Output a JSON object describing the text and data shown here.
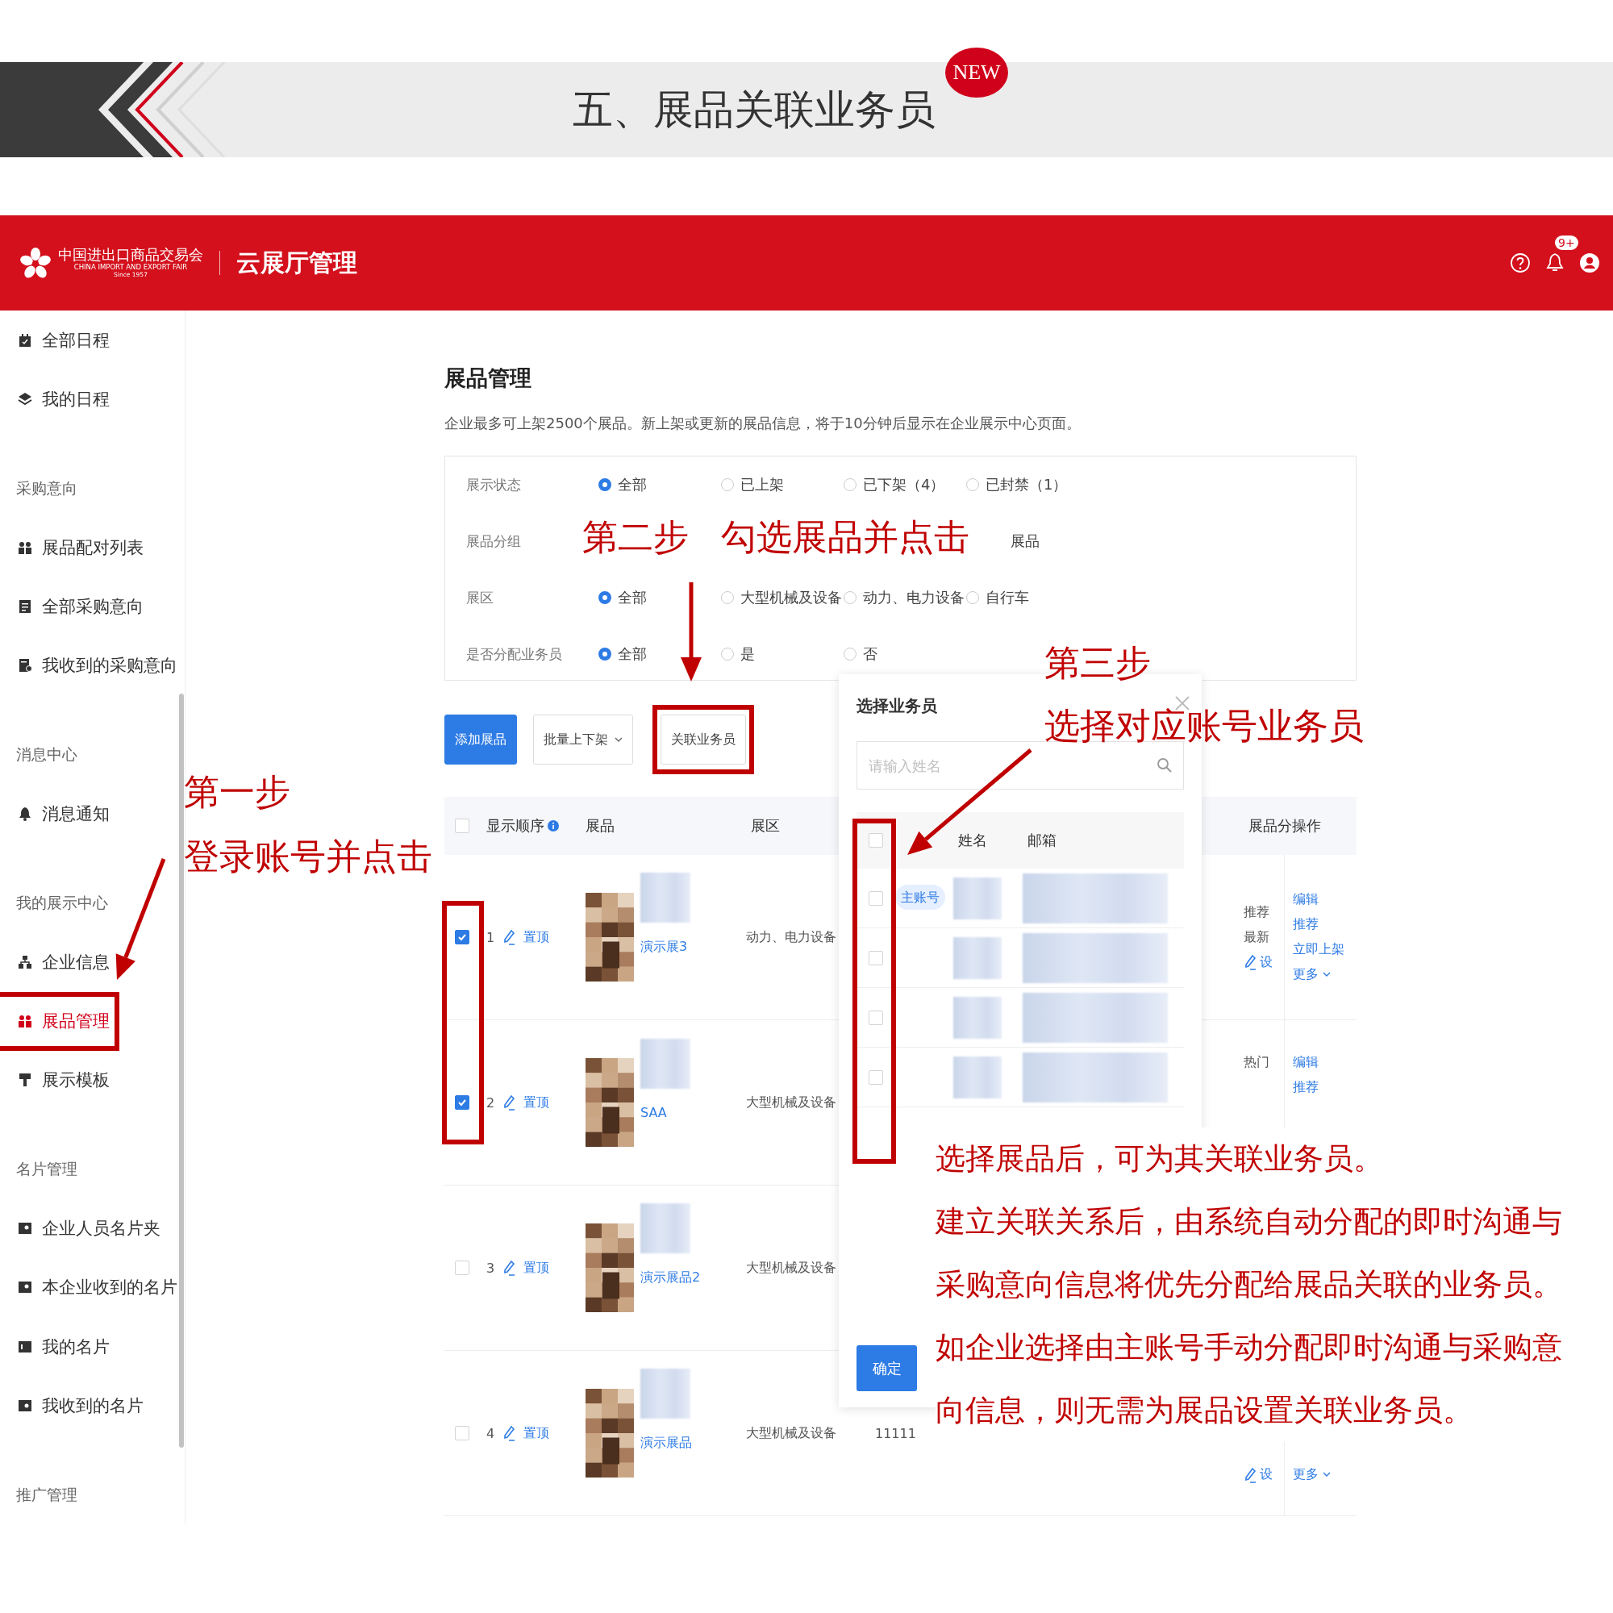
{
  "slide_title": {
    "text": "五、展品关联业务员",
    "badge": "NEW"
  },
  "header": {
    "logo_cn": "中国进出口商品交易会",
    "logo_en": "CHINA IMPORT AND EXPORT FAIR",
    "logo_since": "Since 1957",
    "app_name": "云展厅管理",
    "notification_badge": "9+"
  },
  "sidebar": {
    "items": [
      {
        "kind": "item",
        "label": "全部日程",
        "selected": false
      },
      {
        "kind": "item",
        "label": "我的日程",
        "selected": false
      },
      {
        "kind": "section",
        "label": "采购意向"
      },
      {
        "kind": "item",
        "label": "展品配对列表",
        "selected": false
      },
      {
        "kind": "item",
        "label": "全部采购意向",
        "selected": false
      },
      {
        "kind": "item",
        "label": "我收到的采购意向",
        "selected": false
      },
      {
        "kind": "section",
        "label": "消息中心"
      },
      {
        "kind": "item",
        "label": "消息通知",
        "selected": false
      },
      {
        "kind": "section",
        "label": "我的展示中心"
      },
      {
        "kind": "item",
        "label": "企业信息",
        "selected": false
      },
      {
        "kind": "item",
        "label": "展品管理",
        "selected": true
      },
      {
        "kind": "item",
        "label": "展示模板",
        "selected": false
      },
      {
        "kind": "section",
        "label": "名片管理"
      },
      {
        "kind": "item",
        "label": "企业人员名片夹",
        "selected": false
      },
      {
        "kind": "item",
        "label": "本企业收到的名片",
        "selected": false
      },
      {
        "kind": "item",
        "label": "我的名片",
        "selected": false
      },
      {
        "kind": "item",
        "label": "我收到的名片",
        "selected": false
      },
      {
        "kind": "section",
        "label": "推广管理"
      }
    ]
  },
  "page": {
    "title": "展品管理",
    "notice": "企业最多可上架2500个展品。新上架或更新的展品信息，将于10分钟后显示在企业展示中心页面。",
    "filters": [
      {
        "label": "展示状态",
        "options": [
          {
            "label": "全部",
            "selected": true
          },
          {
            "label": "已上架",
            "selected": false
          },
          {
            "label": "已下架（4）",
            "selected": false
          },
          {
            "label": "已封禁（1）",
            "selected": false
          }
        ]
      },
      {
        "label": "展品分组",
        "options": [
          {
            "label": "展品"
          }
        ]
      },
      {
        "label": "展区",
        "options": [
          {
            "label": "全部",
            "selected": true
          },
          {
            "label": "大型机械及设备",
            "selected": false
          },
          {
            "label": "动力、电力设备",
            "selected": false
          },
          {
            "label": "自行车",
            "selected": false
          }
        ]
      },
      {
        "label": "是否分配业务员",
        "options": [
          {
            "label": "全部",
            "selected": true
          },
          {
            "label": "是",
            "selected": false
          },
          {
            "label": "否",
            "selected": false
          }
        ]
      }
    ],
    "buttons": [
      {
        "kind": "primary",
        "label": "添加展品"
      },
      {
        "kind": "dropdown",
        "label": "批量上下架"
      },
      {
        "kind": "default",
        "label": "关联业务员"
      }
    ],
    "table": {
      "header_checked": false,
      "columns": [
        "显示顺序",
        "展品",
        "展区",
        "展品分",
        "操作"
      ],
      "rows": [
        {
          "checked": true,
          "order": "1",
          "pin": "置顶",
          "name": "演示展3",
          "zone": "动力、电力设备",
          "group_tags": [
            "推荐",
            "最新"
          ],
          "group_setting": "设",
          "actions": [
            "编辑",
            "推荐",
            "立即上架"
          ],
          "more": "更多"
        },
        {
          "checked": true,
          "order": "2",
          "pin": "置顶",
          "name": "SAA",
          "zone": "大型机械及设备",
          "group_tags": [
            "热门"
          ],
          "actions": [
            "编辑",
            "推荐"
          ]
        },
        {
          "checked": false,
          "order": "3",
          "pin": "置顶",
          "name": "演示展品2",
          "zone": "大型机械及设备"
        },
        {
          "checked": false,
          "order": "4",
          "pin": "置顶",
          "name": "演示展品",
          "zone": "大型机械及设备",
          "column_5": "11111",
          "group_setting": "设",
          "more": "更多"
        }
      ]
    }
  },
  "dialog": {
    "title": "选择业务员",
    "search": {
      "placeholder": "请输入姓名"
    },
    "columns": [
      "姓名",
      "邮箱"
    ],
    "header_checked": false,
    "rows": [
      {
        "checked": false,
        "badge": "主账号"
      },
      {
        "checked": false
      },
      {
        "checked": false
      },
      {
        "checked": false
      }
    ],
    "confirm": "确定"
  },
  "annotations": {
    "steps": [
      {
        "title": "第一步",
        "text": "登录账号并点击"
      },
      {
        "title": "第二步",
        "text": "勾选展品并点击"
      },
      {
        "title": "第三步",
        "text": "选择对应账号业务员"
      }
    ],
    "note_lines": [
      "选择展品后，可为其关联业务员。",
      "建立关联关系后，由系统自动分配的即时沟通与",
      "采购意向信息将优先分配给展品关联的业务员。",
      "如企业选择由主账号手动分配即时沟通与采购意",
      "向信息，则无需为展品设置关联业务员。"
    ]
  }
}
